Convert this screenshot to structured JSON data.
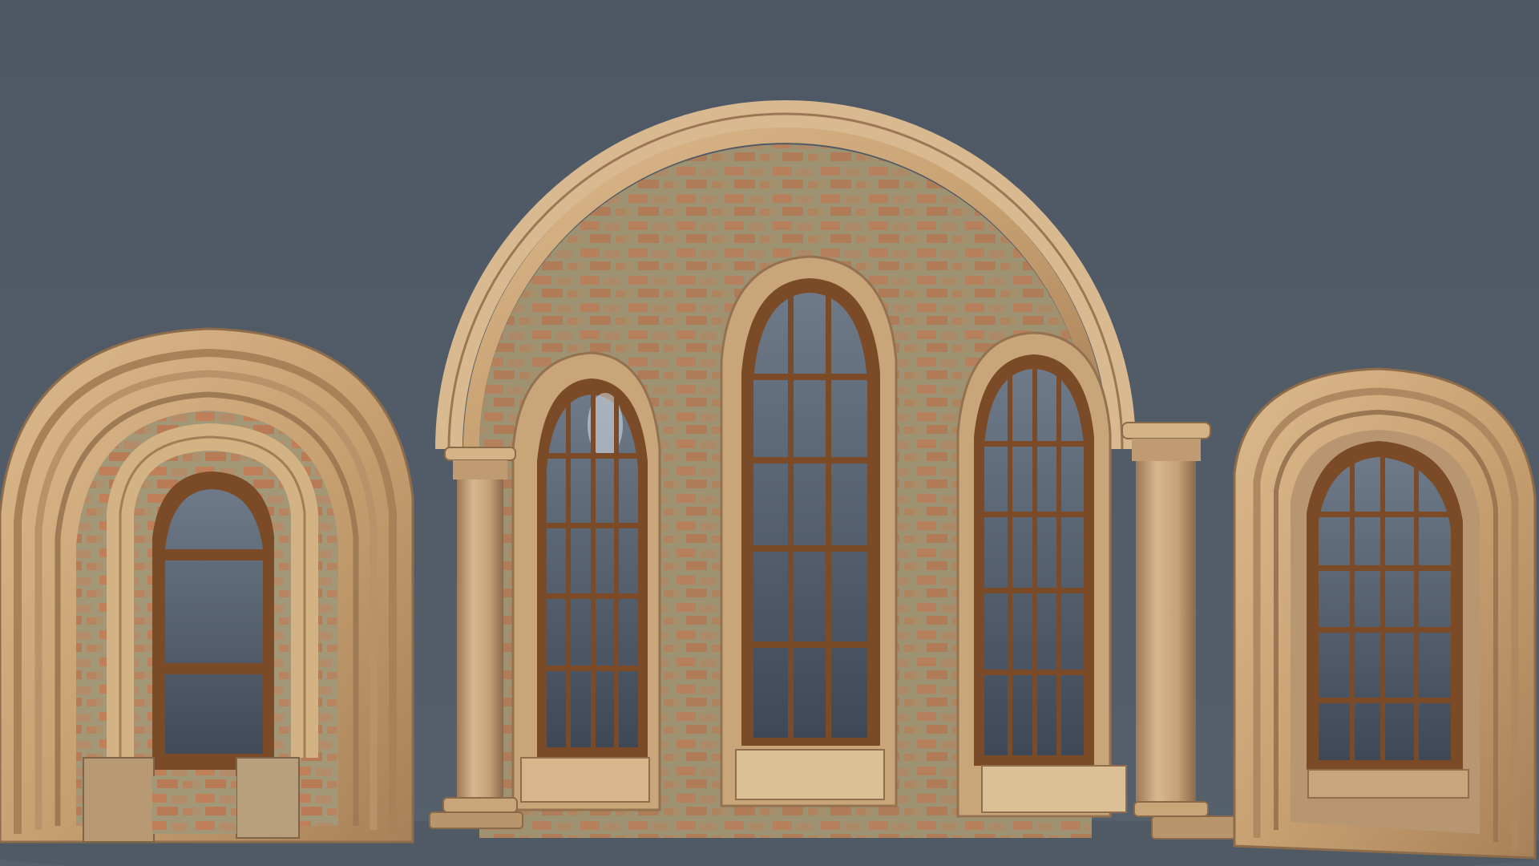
{
  "scene": {
    "background_color": "#4f5965",
    "floor_color": "#56606b",
    "description_items": [
      "left-arched-window-model",
      "center-triple-window-facade-model",
      "right-arched-window-model"
    ]
  },
  "materials": {
    "stone_light": "#d7b487",
    "stone_mid": "#c29a6d",
    "stone_dark": "#8f6d4d",
    "wall_plaster": "#9c9272",
    "brick": "#c9784f",
    "wood_frame": "#7a4b26",
    "glass": "#4b5565",
    "glass_highlight": "#c8d1dc"
  }
}
